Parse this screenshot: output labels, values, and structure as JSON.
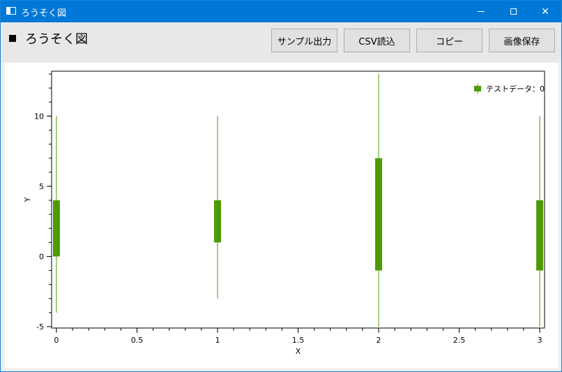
{
  "window": {
    "title": "ろうそく図"
  },
  "header": {
    "title": "ろうそく図"
  },
  "toolbar": {
    "sample_label": "サンプル出力",
    "csv_label": "CSV読込",
    "copy_label": "コピー",
    "save_label": "画像保存"
  },
  "colors": {
    "series": "#4e9a06",
    "titlebar": "#0078d7"
  },
  "chart_data": {
    "type": "candlestick",
    "xlabel": "X",
    "ylabel": "Y",
    "xlim": [
      -0.03,
      3.03
    ],
    "ylim": [
      -5.1,
      13.2
    ],
    "xticks": [
      0,
      0.5,
      1,
      1.5,
      2,
      2.5,
      3
    ],
    "xtick_labels": [
      "0",
      "0.5",
      "1",
      "1.5",
      "2",
      "2.5",
      "3"
    ],
    "yticks": [
      -5,
      0,
      5,
      10
    ],
    "ytick_labels": [
      "-5",
      "0",
      "5",
      "10"
    ],
    "legend": {
      "label": "テストデータ：0",
      "placement": "top-right"
    },
    "series": [
      {
        "name": "テストデータ：0",
        "points": [
          {
            "x": 0,
            "open": 0,
            "close": 4,
            "low": -4,
            "high": 10
          },
          {
            "x": 1,
            "open": 1,
            "close": 4,
            "low": -3,
            "high": 10
          },
          {
            "x": 2,
            "open": -1,
            "close": 7,
            "low": -5,
            "high": 13
          },
          {
            "x": 3,
            "open": -1,
            "close": 4,
            "low": -5,
            "high": 10
          }
        ]
      }
    ]
  }
}
